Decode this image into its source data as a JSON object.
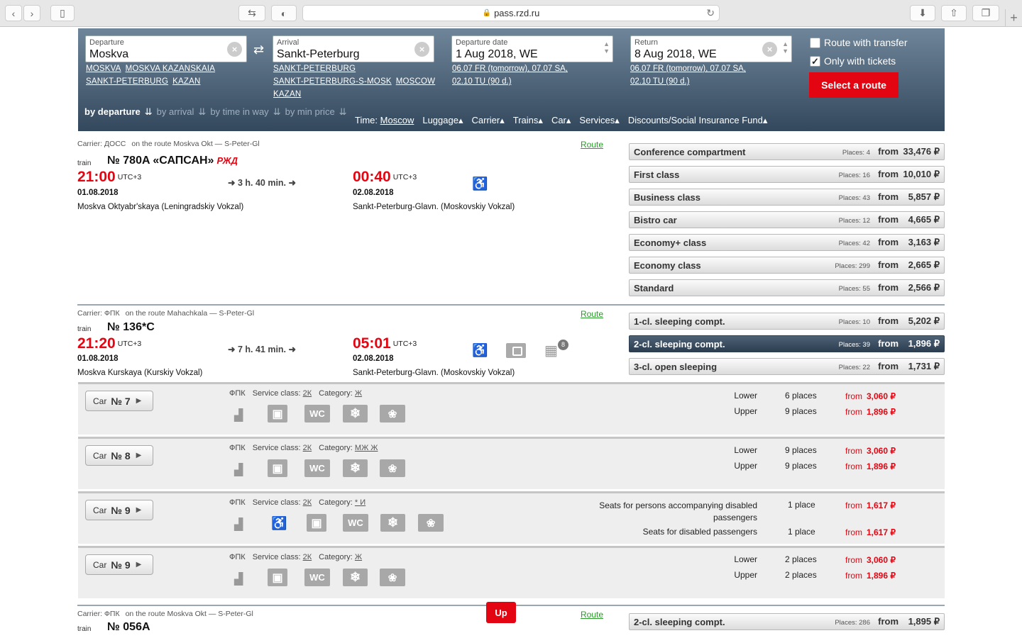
{
  "browser": {
    "url": "pass.rzd.ru"
  },
  "search": {
    "departure": {
      "label": "Departure",
      "value": "Moskva",
      "suggest": [
        "MOSKVA",
        "MOSKVA KAZANSKAIA",
        "SANKT-PETERBURG",
        "KAZAN"
      ]
    },
    "arrival": {
      "label": "Arrival",
      "value": "Sankt-Peterburg",
      "suggest": [
        "SANKT-PETERBURG",
        "SANKT-PETERBURG-S-MOSK",
        "MOSCOW",
        "KAZAN"
      ]
    },
    "depart_date": {
      "label": "Departure date",
      "value": "1 Aug 2018, WE",
      "hint1": "06.07 FR (tomorrow), 07.07 SA,",
      "hint2": "02.10 TU (90 d.)"
    },
    "return_date": {
      "label": "Return",
      "value": "8 Aug 2018, WE",
      "hint1": "06.07 FR (tomorrow), 07.07 SA,",
      "hint2": "02.10 TU (90 d.)"
    },
    "route_transfer": "Route with transfer",
    "only_tickets": "Only with tickets",
    "select_route": "Select a route"
  },
  "sort": {
    "by_departure": "by departure",
    "by_arrival": "by arrival",
    "by_time": "by time in way",
    "by_price": "by min price"
  },
  "filters": {
    "time_label": "Time:",
    "time_value": "Moscow",
    "luggage": "Luggage",
    "carrier": "Carrier",
    "trains": "Trains",
    "car": "Car",
    "services": "Services",
    "discounts": "Discounts/Social Insurance Fund"
  },
  "trains": [
    {
      "carrier": "Carrier: ДОСС",
      "route": "on the route Moskva Okt — S-Peter-Gl",
      "route_link": "Route",
      "label": "train",
      "number": "№ 780A «САПСАН»",
      "brand": "РЖД",
      "dep_time": "21:00",
      "dep_tz": "UTC+3",
      "dep_date": "01.08.2018",
      "dep_station": "Moskva Oktyabr'skaya (Leningradskiy Vokzal)",
      "duration": "3 h. 40 min.",
      "arr_time": "00:40",
      "arr_tz": "UTC+3",
      "arr_date": "02.08.2018",
      "arr_station": "Sankt-Peterburg-Glavn. (Moskovskiy Vokzal)",
      "classes": [
        {
          "name": "Conference compartment",
          "places": "Places: 4",
          "from": "from",
          "price": "33,476 ₽"
        },
        {
          "name": "First class",
          "places": "Places: 16",
          "from": "from",
          "price": "10,010 ₽"
        },
        {
          "name": "Business class",
          "places": "Places: 43",
          "from": "from",
          "price": "5,857 ₽"
        },
        {
          "name": "Bistro car",
          "places": "Places: 12",
          "from": "from",
          "price": "4,665 ₽"
        },
        {
          "name": "Economy+ class",
          "places": "Places: 42",
          "from": "from",
          "price": "3,163 ₽"
        },
        {
          "name": "Economy class",
          "places": "Places: 299",
          "from": "from",
          "price": "2,665 ₽"
        },
        {
          "name": "Standard",
          "places": "Places: 55",
          "from": "from",
          "price": "2,566 ₽"
        }
      ]
    },
    {
      "carrier": "Carrier: ФПК",
      "route": "on the route Mahachkala — S-Peter-Gl",
      "route_link": "Route",
      "label": "train",
      "number": "№ 136*С",
      "dep_time": "21:20",
      "dep_tz": "UTC+3",
      "dep_date": "01.08.2018",
      "dep_station": "Moskva Kurskaya (Kurskiy Vokzal)",
      "duration": "7 h. 41 min.",
      "arr_time": "05:01",
      "arr_tz": "UTC+3",
      "arr_date": "02.08.2018",
      "arr_station": "Sankt-Peterburg-Glavn. (Moskovskiy Vokzal)",
      "badge": "8",
      "classes": [
        {
          "name": "1-cl. sleeping compt.",
          "places": "Places: 10",
          "from": "from",
          "price": "5,202 ₽"
        },
        {
          "name": "2-cl. sleeping compt.",
          "places": "Places: 39",
          "from": "from",
          "price": "1,896 ₽"
        },
        {
          "name": "3-cl. open sleeping",
          "places": "Places: 22",
          "from": "from",
          "price": "1,731 ₽"
        }
      ]
    },
    {
      "carrier": "Carrier: ФПК",
      "route": "on the route Moskva Okt — S-Peter-Gl",
      "route_link": "Route",
      "label": "train",
      "number": "№ 056A",
      "classes": [
        {
          "name": "2-cl. sleeping compt.",
          "places": "Places: 286",
          "from": "from",
          "price": "1,895 ₽"
        }
      ]
    }
  ],
  "cars": [
    {
      "car": "Car",
      "num": "№ 7",
      "carrier": "ФПК",
      "service_label": "Service class:",
      "service": "2К",
      "category_label": "Category:",
      "category": "Ж",
      "seats": [
        {
          "type": "Lower",
          "count": "6 places",
          "from": "from",
          "price": "3,060 ₽"
        },
        {
          "type": "Upper",
          "count": "9 places",
          "from": "from",
          "price": "1,896 ₽"
        }
      ]
    },
    {
      "car": "Car",
      "num": "№ 8",
      "carrier": "ФПК",
      "service_label": "Service class:",
      "service": "2К",
      "category_label": "Category:",
      "category": "МЖ Ж",
      "seats": [
        {
          "type": "Lower",
          "count": "9 places",
          "from": "from",
          "price": "3,060 ₽"
        },
        {
          "type": "Upper",
          "count": "9 places",
          "from": "from",
          "price": "1,896 ₽"
        }
      ]
    },
    {
      "car": "Car",
      "num": "№ 9",
      "carrier": "ФПК",
      "service_label": "Service class:",
      "service": "2К",
      "category_label": "Category:",
      "category": "* И",
      "seats": [
        {
          "type": "Seats for persons accompanying disabled passengers",
          "count": "1 place",
          "from": "from",
          "price": "1,617 ₽"
        },
        {
          "type": "Seats for disabled passengers",
          "count": "1 place",
          "from": "from",
          "price": "1,617 ₽"
        }
      ]
    },
    {
      "car": "Car",
      "num": "№ 9",
      "carrier": "ФПК",
      "service_label": "Service class:",
      "service": "2К",
      "category_label": "Category:",
      "category": "Ж",
      "seats": [
        {
          "type": "Lower",
          "count": "2 places",
          "from": "from",
          "price": "3,060 ₽"
        },
        {
          "type": "Upper",
          "count": "2 places",
          "from": "from",
          "price": "1,896 ₽"
        }
      ]
    }
  ],
  "icons": {
    "wc": "WC",
    "up": "Up"
  }
}
